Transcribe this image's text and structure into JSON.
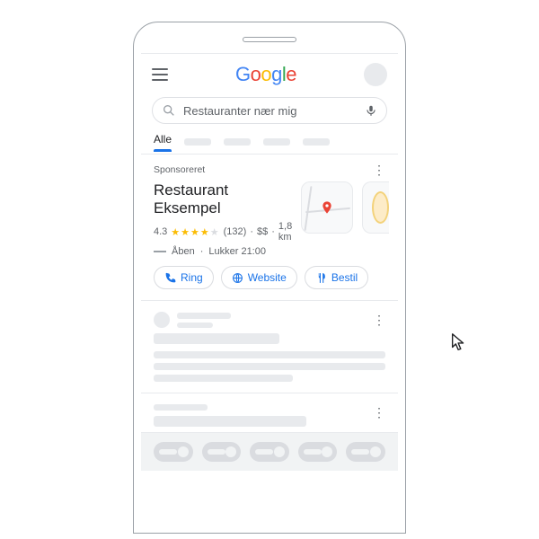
{
  "header": {
    "logo_text": "Google"
  },
  "search": {
    "query": "Restauranter nær mig"
  },
  "tabs": {
    "active": "Alle"
  },
  "ad": {
    "sponsored_label": "Sponsoreret",
    "name": "Restaurant Eksempel",
    "rating": "4.3",
    "reviews": "(132)",
    "price": "$$",
    "distance": "1,8 km",
    "open_status": "Åben",
    "closing": "Lukker 21:00",
    "actions": {
      "call": "Ring",
      "website": "Website",
      "order": "Bestil"
    }
  }
}
